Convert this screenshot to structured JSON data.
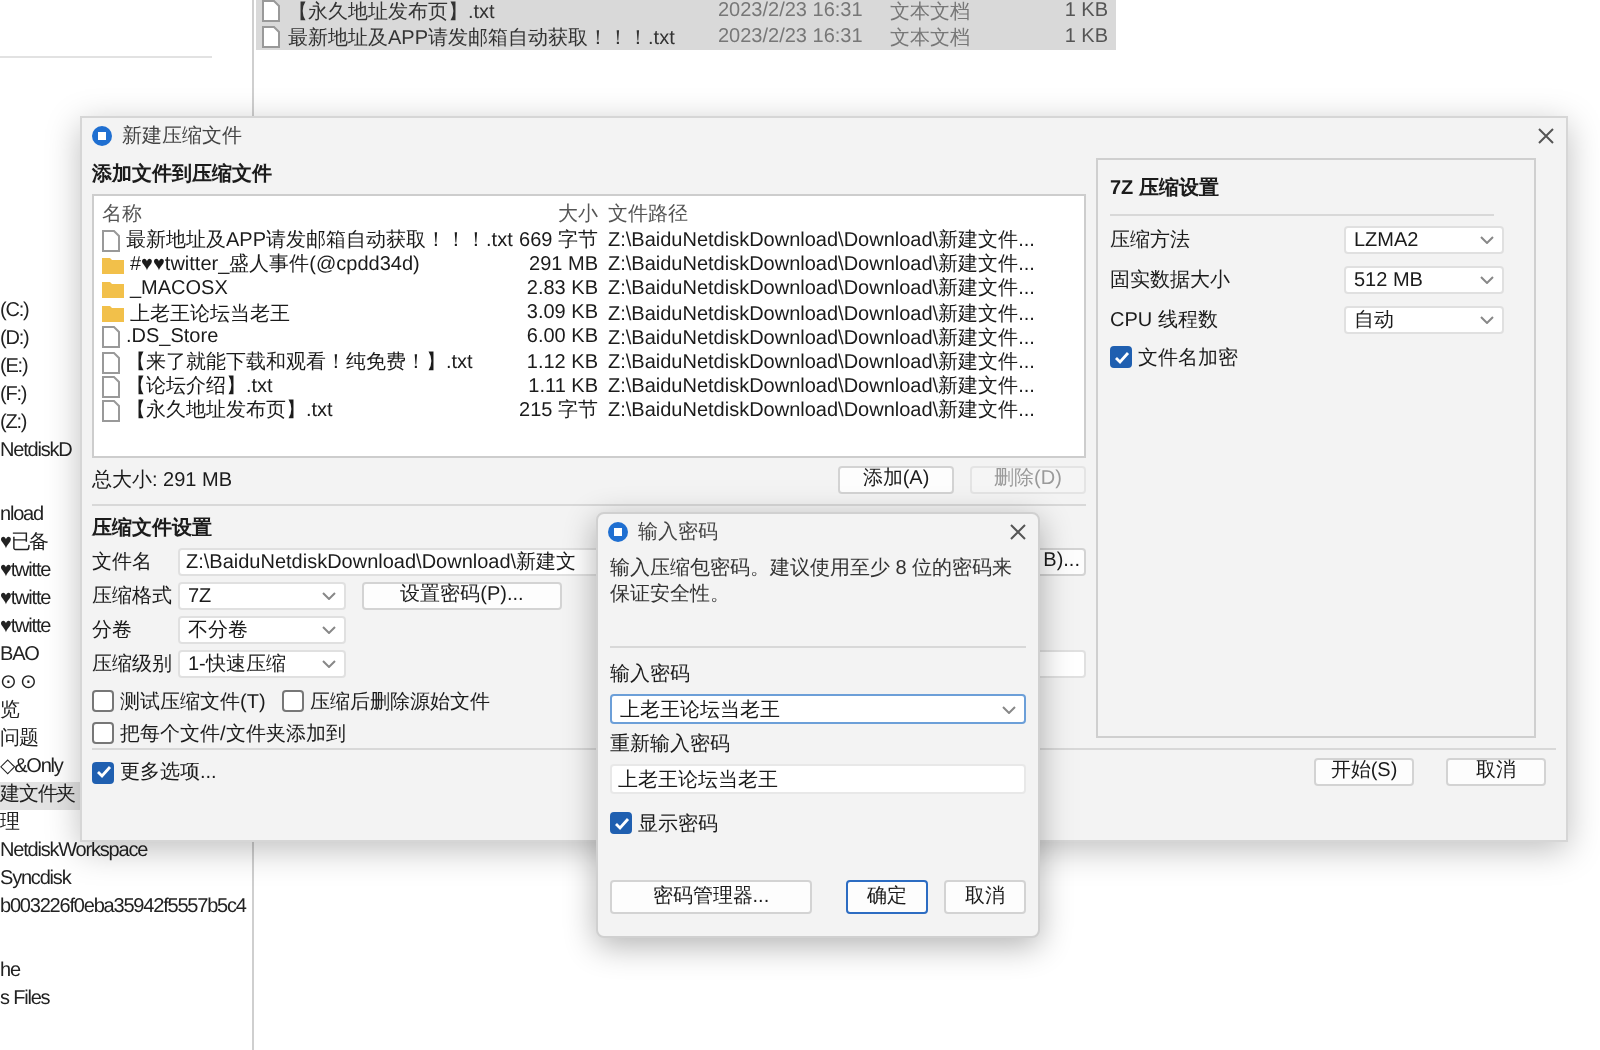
{
  "explorer": {
    "files": [
      {
        "name": "【永久地址发布页】.txt",
        "modified": "2023/2/23 16:31",
        "type": "文本文档",
        "size": "1 KB",
        "selected": true
      },
      {
        "name": "最新地址及APP请发邮箱自动获取！！！.txt",
        "modified": "2023/2/23 16:31",
        "type": "文本文档",
        "size": "1 KB",
        "selected": true
      }
    ],
    "sidebar_groups": [
      {
        "items": [
          {
            "label": "(C:)",
            "selected": false
          },
          {
            "label": "(D:)",
            "selected": false
          },
          {
            "label": "(E:)",
            "selected": false
          },
          {
            "label": "(F:)",
            "selected": false
          },
          {
            "label": "(Z:)",
            "selected": false
          },
          {
            "label": "NetdiskD",
            "selected": false
          }
        ]
      },
      {
        "items": [
          {
            "label": "nload",
            "selected": false
          },
          {
            "label": "♥已备",
            "selected": false
          },
          {
            "label": "♥twitte",
            "selected": false
          },
          {
            "label": "♥twitte",
            "selected": false
          },
          {
            "label": "♥twitte",
            "selected": false
          },
          {
            "label": "BAO",
            "selected": false
          },
          {
            "label": "⊙ ⊙",
            "selected": false
          },
          {
            "label": "览",
            "selected": false
          },
          {
            "label": "问题",
            "selected": false
          },
          {
            "label": "◇&Only",
            "selected": false
          },
          {
            "label": "建文件夹",
            "selected": true
          },
          {
            "label": "理",
            "selected": false
          },
          {
            "label": "NetdiskWorkspace",
            "selected": false
          },
          {
            "label": "Syncdisk",
            "selected": false
          },
          {
            "label": "b003226f0eba35942f5557b5c4",
            "selected": false
          }
        ]
      },
      {
        "items": [
          {
            "label": "he",
            "selected": false
          },
          {
            "label": "s Files",
            "selected": false
          }
        ]
      }
    ]
  },
  "compress_dialog": {
    "title": "新建压缩文件",
    "add_section_title": "添加文件到压缩文件",
    "file_table": {
      "columns": [
        "名称",
        "大小",
        "文件路径"
      ],
      "rows": [
        {
          "kind": "file",
          "name": "最新地址及APP请发邮箱自动获取！！！.txt",
          "size": "669 字节",
          "path": "Z:\\BaiduNetdiskDownload\\Download\\新建文件..."
        },
        {
          "kind": "folder",
          "name": "#♥♥twitter_盛人事件(@cpdd34d)",
          "size": "291 MB",
          "path": "Z:\\BaiduNetdiskDownload\\Download\\新建文件..."
        },
        {
          "kind": "folder",
          "name": "_MACOSX",
          "size": "2.83 KB",
          "path": "Z:\\BaiduNetdiskDownload\\Download\\新建文件..."
        },
        {
          "kind": "folder",
          "name": "上老王论坛当老王",
          "size": "3.09 KB",
          "path": "Z:\\BaiduNetdiskDownload\\Download\\新建文件..."
        },
        {
          "kind": "file",
          "name": ".DS_Store",
          "size": "6.00 KB",
          "path": "Z:\\BaiduNetdiskDownload\\Download\\新建文件..."
        },
        {
          "kind": "file",
          "name": "【来了就能下载和观看！纯免费！】.txt",
          "size": "1.12 KB",
          "path": "Z:\\BaiduNetdiskDownload\\Download\\新建文件..."
        },
        {
          "kind": "file",
          "name": "【论坛介绍】.txt",
          "size": "1.11 KB",
          "path": "Z:\\BaiduNetdiskDownload\\Download\\新建文件..."
        },
        {
          "kind": "file",
          "name": "【永久地址发布页】.txt",
          "size": "215 字节",
          "path": "Z:\\BaiduNetdiskDownload\\Download\\新建文件..."
        }
      ]
    },
    "total_size": "总大小: 291 MB",
    "list_buttons": [
      {
        "label": "添加(A)",
        "disabled": false
      },
      {
        "label": "删除(D)",
        "disabled": true
      }
    ],
    "settings_title": "压缩文件设置",
    "archive_name": {
      "label": "文件名",
      "value": "Z:\\BaiduNetdiskDownload\\Download\\新建文",
      "browse_button": "B)..."
    },
    "format": {
      "label": "压缩格式",
      "value": "7Z",
      "password_button": "设置密码(P)..."
    },
    "split": {
      "label": "分卷",
      "value": "不分卷"
    },
    "level": {
      "label": "压缩级别",
      "value": "1-快速压缩"
    },
    "options": [
      {
        "label": "测试压缩文件(T)",
        "checked": false
      },
      {
        "label": "压缩后删除源始文件",
        "checked": false
      },
      {
        "label": "把每个文件/文件夹添加到",
        "checked": false
      }
    ],
    "more_options": {
      "label": "更多选项...",
      "checked": true
    },
    "buttons": [
      "开始(S)",
      "取消"
    ],
    "panel": {
      "title": "7Z 压缩设置",
      "settings": [
        {
          "label": "压缩方法",
          "value": "LZMA2"
        },
        {
          "label": "固实数据大小",
          "value": "512 MB"
        },
        {
          "label": "CPU 线程数",
          "value": "自动"
        }
      ],
      "encrypt_names": {
        "label": "文件名加密",
        "checked": true
      }
    }
  },
  "password_dialog": {
    "title": "输入密码",
    "hint": "输入压缩包密码。建议使用至少 8 位的密码来保证安全性。",
    "password_label": "输入密码",
    "password": "上老王论坛当老王",
    "confirm_label": "重新输入密码",
    "confirm": "上老王论坛当老王",
    "show_password": {
      "label": "显示密码",
      "checked": true
    },
    "buttons": [
      {
        "label": "密码管理器...",
        "default": false
      },
      {
        "label": "确定",
        "default": true
      },
      {
        "label": "取消",
        "default": false
      }
    ]
  }
}
